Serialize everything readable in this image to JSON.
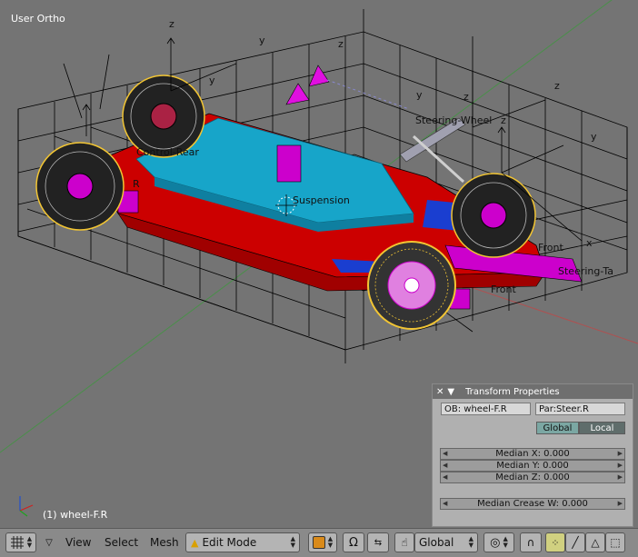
{
  "viewport": {
    "view_name": "User Ortho",
    "selected_object": "(1) wheel-F.R",
    "object_labels": {
      "steering_wheel": "Steering-Wheel",
      "control_rear": "Control-Rear",
      "suspension": "Suspension",
      "front_right": "Front",
      "front_left": "Front",
      "steering_target": "Steering-Ta",
      "rear_small": "R"
    },
    "axis_labels": {
      "z": "z",
      "y": "y",
      "x": "x"
    }
  },
  "transform_panel": {
    "title": "Transform Properties",
    "object_field": "OB: wheel-F.R",
    "parent_field": "Par:Steer.R",
    "global_label": "Global",
    "local_label": "Local",
    "median_x": "Median X: 0.000",
    "median_y": "Median Y: 0.000",
    "median_z": "Median Z: 0.000",
    "median_crease": "Median Crease W: 0.000"
  },
  "header": {
    "menus": {
      "view": "View",
      "select": "Select",
      "mesh": "Mesh"
    },
    "mode": "Edit Mode",
    "orientation": "Global"
  },
  "colors": {
    "viewport_bg": "#747474",
    "car_body": "#cc0000",
    "car_top": "#17a5c9",
    "magenta": "#cc00cc",
    "wheel_highlight": "#f2c533"
  }
}
